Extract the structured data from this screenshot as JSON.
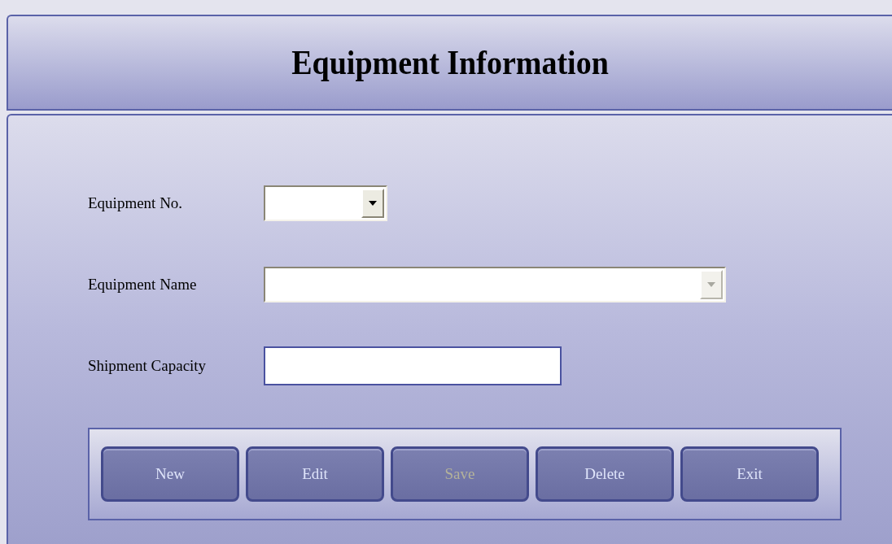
{
  "window": {
    "title": "Equipment Information"
  },
  "fields": [
    {
      "kind": "combo",
      "label": "Equipment No.",
      "disabled": false
    },
    {
      "kind": "combo",
      "label": "Equipment Name",
      "disabled": true
    },
    {
      "kind": "text",
      "label": "Shipment Capacity"
    }
  ],
  "buttons": [
    {
      "label": "New",
      "disabled": false
    },
    {
      "label": "Edit",
      "disabled": false
    },
    {
      "label": "Save",
      "disabled": true
    },
    {
      "label": "Delete",
      "disabled": false
    },
    {
      "label": "Exit",
      "disabled": false
    }
  ]
}
